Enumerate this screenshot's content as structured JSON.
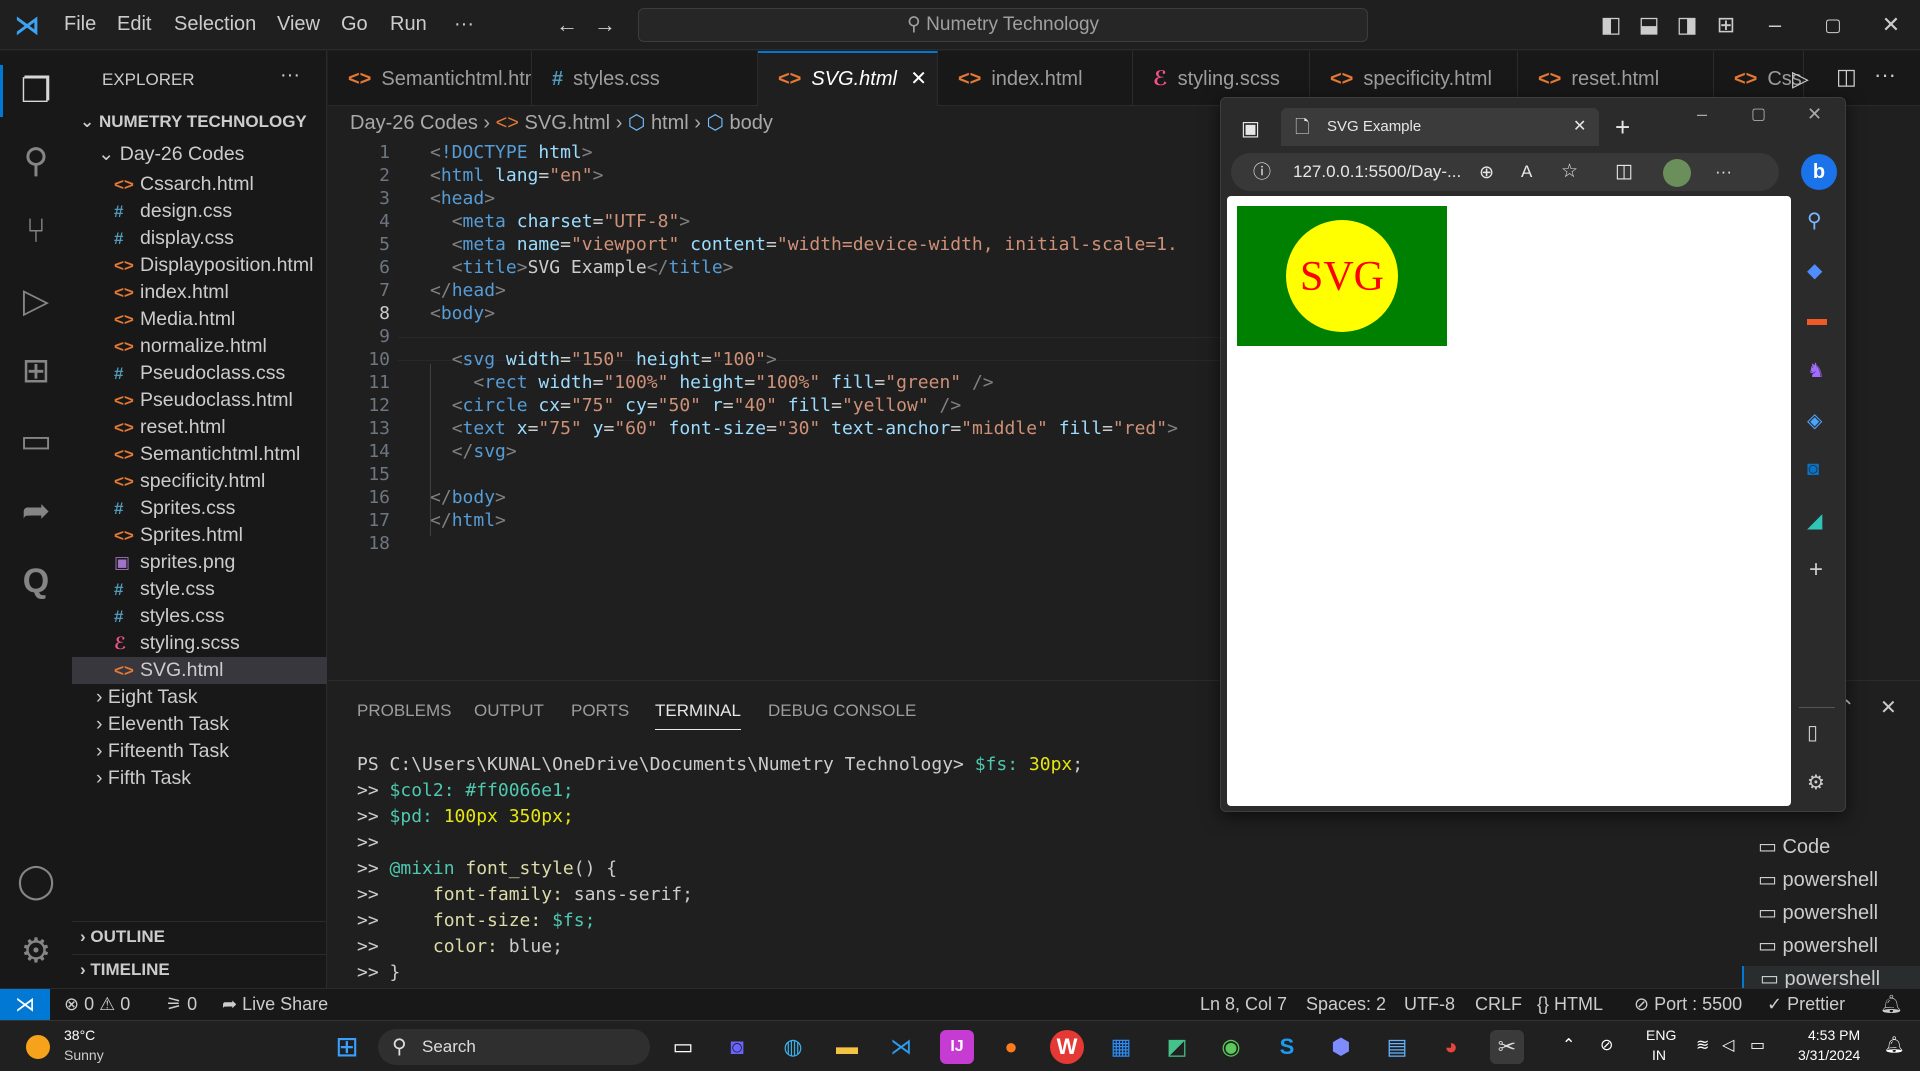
{
  "menu": [
    "File",
    "Edit",
    "Selection",
    "View",
    "Go",
    "Run",
    "···"
  ],
  "search": {
    "text": "Numetry Technology"
  },
  "explorer": {
    "title": "EXPLORER",
    "root": "NUMETRY TECHNOLOGY",
    "folder": "Day-26 Codes",
    "files": [
      {
        "name": "Cssarch.html",
        "icon": "<>"
      },
      {
        "name": "design.css",
        "icon": "#"
      },
      {
        "name": "display.css",
        "icon": "#"
      },
      {
        "name": "Displayposition.html",
        "icon": "<>"
      },
      {
        "name": "index.html",
        "icon": "<>"
      },
      {
        "name": "Media.html",
        "icon": "<>"
      },
      {
        "name": "normalize.html",
        "icon": "<>"
      },
      {
        "name": "Pseudoclass.css",
        "icon": "#"
      },
      {
        "name": "Pseudoclass.html",
        "icon": "<>"
      },
      {
        "name": "reset.html",
        "icon": "<>"
      },
      {
        "name": "Semantichtml.html",
        "icon": "<>"
      },
      {
        "name": "specificity.html",
        "icon": "<>"
      },
      {
        "name": "Sprites.css",
        "icon": "#"
      },
      {
        "name": "Sprites.html",
        "icon": "<>"
      },
      {
        "name": "sprites.png",
        "icon": "▣"
      },
      {
        "name": "style.css",
        "icon": "#"
      },
      {
        "name": "styles.css",
        "icon": "#"
      },
      {
        "name": "styling.scss",
        "icon": "ℰ"
      },
      {
        "name": "SVG.html",
        "icon": "<>"
      }
    ],
    "folders": [
      "Eight Task",
      "Eleventh Task",
      "Fifteenth Task",
      "Fifth Task"
    ],
    "outline": "OUTLINE",
    "timeline": "TIMELINE"
  },
  "tabs": [
    {
      "label": "Semantichtml.html",
      "icon": "<>"
    },
    {
      "label": "styles.css",
      "icon": "#"
    },
    {
      "label": "SVG.html",
      "icon": "<>",
      "close": "✕"
    },
    {
      "label": "index.html",
      "icon": "<>"
    },
    {
      "label": "styling.scss",
      "icon": "ℰ"
    },
    {
      "label": "specificity.html",
      "icon": "<>"
    },
    {
      "label": "reset.html",
      "icon": "<>"
    },
    {
      "label": "Cssa",
      "icon": "<>"
    }
  ],
  "breadcrumb": [
    "Day-26 Codes",
    "SVG.html",
    "html",
    "body"
  ],
  "line_numbers": [
    "1",
    "2",
    "3",
    "4",
    "5",
    "6",
    "7",
    "8",
    "9",
    "10",
    "11",
    "12",
    "13",
    "14",
    "15",
    "16",
    "17",
    "18"
  ],
  "panel_tabs": [
    "PROBLEMS",
    "OUTPUT",
    "PORTS",
    "TERMINAL",
    "DEBUG CONSOLE"
  ],
  "terminal": {
    "prompt": "PS C:\\Users\\KUNAL\\OneDrive\\Documents\\Numetry Technology> ",
    "l1_var": "$fs: ",
    "l1_val": "30px",
    "l2_var": "$col2: ",
    "l2_val": "#ff0066e1;",
    "l3_var": "$pd: ",
    "l3_val": "100px 350px;",
    "l5_kw": "@mixin ",
    "l5_fn": "font_style",
    "l6_prop": "font-family: ",
    "l6_val": "sans-serif;",
    "l7_prop": "font-size: ",
    "l7_val": "$fs;",
    "l8_prop": "color: ",
    "l8_val": "blue;"
  },
  "terminal_list": [
    "Code",
    "powershell",
    "powershell",
    "powershell",
    "powershell"
  ],
  "browser": {
    "tab_title": "SVG Example",
    "url": "127.0.0.1:5500/Day-...",
    "svg_text": "SVG",
    "svg_colors": {
      "rect": "#008000",
      "circle": "#ffff00",
      "text": "#ff0000"
    }
  },
  "status": {
    "errors": "0",
    "warnings": "0",
    "ports": "0",
    "live_share": "Live Share",
    "position": "Ln 8, Col 7",
    "spaces": "Spaces: 2",
    "encoding": "UTF-8",
    "eol": "CRLF",
    "language": "HTML",
    "port": "Port : 5500",
    "prettier": "Prettier"
  },
  "taskbar": {
    "weather_temp": "38°C",
    "weather_desc": "Sunny",
    "search": "Search",
    "lang": "ENG",
    "lang2": "IN",
    "time": "4:53 PM",
    "date": "3/31/2024"
  },
  "colors": {
    "accent": "#0078d4",
    "selection": "#37373d"
  }
}
